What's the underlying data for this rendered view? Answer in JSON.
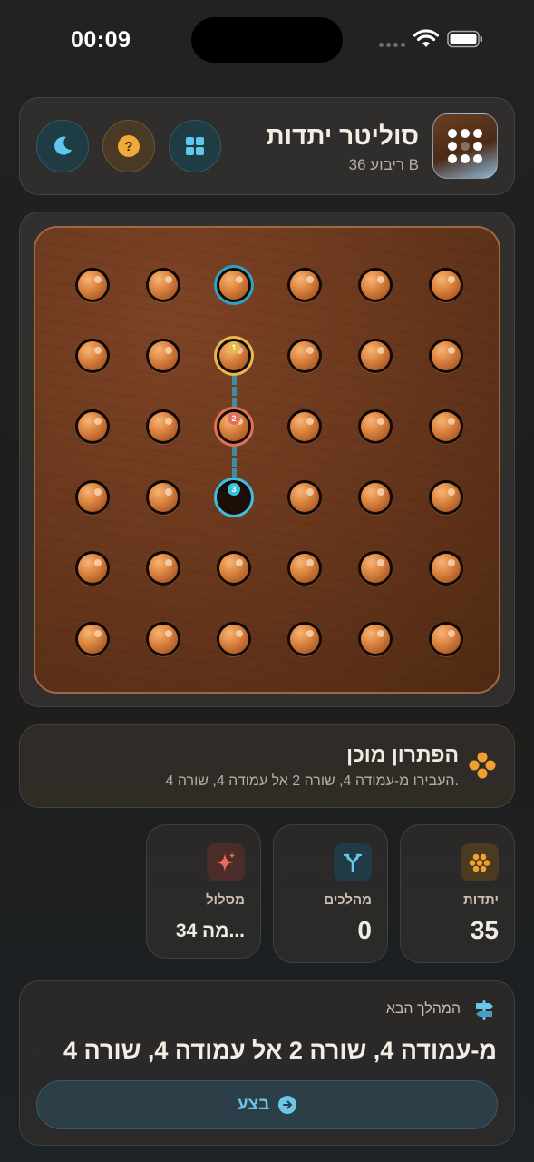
{
  "status_bar": {
    "time": "00:09"
  },
  "header": {
    "title": "סוליטר יתדות",
    "subtitle": "ריבוע 36 B",
    "buttons": [
      "layout-grid-icon",
      "help-icon",
      "moon-icon"
    ]
  },
  "board": {
    "rows": 6,
    "cols": 6,
    "empty_cells": [
      [
        4,
        3
      ]
    ],
    "highlight": {
      "selected": [
        1,
        3
      ],
      "path": [
        {
          "step": "1",
          "cell": [
            2,
            3
          ],
          "color": "#e6b84a"
        },
        {
          "step": "2",
          "cell": [
            3,
            3
          ],
          "color": "#e0705a"
        },
        {
          "step": "3",
          "cell": [
            4,
            3
          ],
          "color": "#3bbfe0"
        }
      ]
    }
  },
  "solution": {
    "title": "הפתרון מוכן",
    "description": "העבירו מ-עמודה 4, שורה 2 אל עמודה 4, שורה 4."
  },
  "stats": [
    {
      "label": "יתדות",
      "value": "35",
      "icon": "pegs-icon",
      "color": "#f0a030"
    },
    {
      "label": "מהלכים",
      "value": "0",
      "icon": "fork-icon",
      "color": "#6cc6e8"
    },
    {
      "label": "מסלול",
      "value": "34 מה...",
      "icon": "sparkle-icon",
      "color": "#e86a5a"
    }
  ],
  "next_move": {
    "label": "המהלך הבא",
    "text": "מ-עמודה 4, שורה 2 אל עמודה 4, שורה 4",
    "button_label": "בצע"
  },
  "colors": {
    "accent": "#6cc6e8",
    "peg": "#e08a45",
    "board": "#6a381d"
  }
}
